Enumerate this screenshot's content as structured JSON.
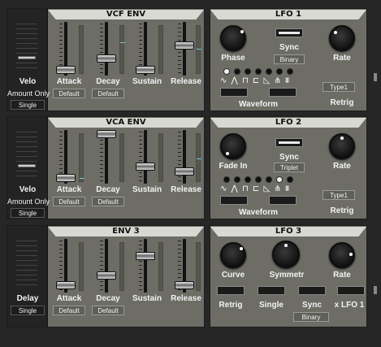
{
  "vcf_env": {
    "title": "VCF ENV",
    "velo": {
      "label": "Velo",
      "mode_label": "Amount Only",
      "curve_label": "Single"
    },
    "faders": [
      {
        "label": "Attack",
        "curve": "Default",
        "level": 0.2
      },
      {
        "label": "Decay",
        "curve": "Default",
        "level": 0.4
      },
      {
        "label": "Sustain",
        "level": 0.08
      },
      {
        "label": "Release",
        "level": 0.62
      }
    ]
  },
  "vca_env": {
    "title": "VCA ENV",
    "velo": {
      "label": "Velo",
      "mode_label": "Amount Only",
      "curve_label": "Single"
    },
    "faders": [
      {
        "label": "Attack",
        "curve": "Default",
        "level": 0.05
      },
      {
        "label": "Decay",
        "curve": "Default",
        "level": 1.0
      },
      {
        "label": "Sustain",
        "level": 0.22
      },
      {
        "label": "Release",
        "level": 0.1
      }
    ]
  },
  "env3": {
    "title": "ENV 3",
    "delay": {
      "label": "Delay",
      "curve_label": "Single"
    },
    "faders": [
      {
        "label": "Attack",
        "curve": "Default",
        "level": 0.05
      },
      {
        "label": "Decay",
        "curve": "Default",
        "level": 0.22
      },
      {
        "label": "Sustain",
        "level": 0.62
      },
      {
        "label": "Release",
        "level": 0.1
      }
    ]
  },
  "lfo1": {
    "title": "LFO 1",
    "phase_label": "Phase",
    "sync_label": "Sync",
    "sync_value": "Binary",
    "rate_label": "Rate",
    "waveform_label": "Waveform",
    "waveform_glyphs": "∿ ⋀ ⊓ ⊏ ◺ ⋔ ⩩",
    "waveform_selected": 0,
    "type_value": "Type1",
    "retrig_label": "Retrig"
  },
  "lfo2": {
    "title": "LFO 2",
    "fade_label": "Fade In",
    "sync_label": "Sync",
    "sync_value": "Triplet",
    "rate_label": "Rate",
    "waveform_label": "Waveform",
    "waveform_glyphs": "∿ ⋀ ⊓ ⊏ ◺ ⋔ ⩩",
    "waveform_selected": 5,
    "type_value": "Type1",
    "retrig_label": "Retrig"
  },
  "lfo3": {
    "title": "LFO 3",
    "curve_label": "Curve",
    "symmetry_label": "Symmetr",
    "rate_label": "Rate",
    "retrig_label": "Retrig",
    "single_label": "Single",
    "sync_label": "Sync",
    "sync_value": "Binary",
    "xlfo_label": "x LFO 1"
  }
}
